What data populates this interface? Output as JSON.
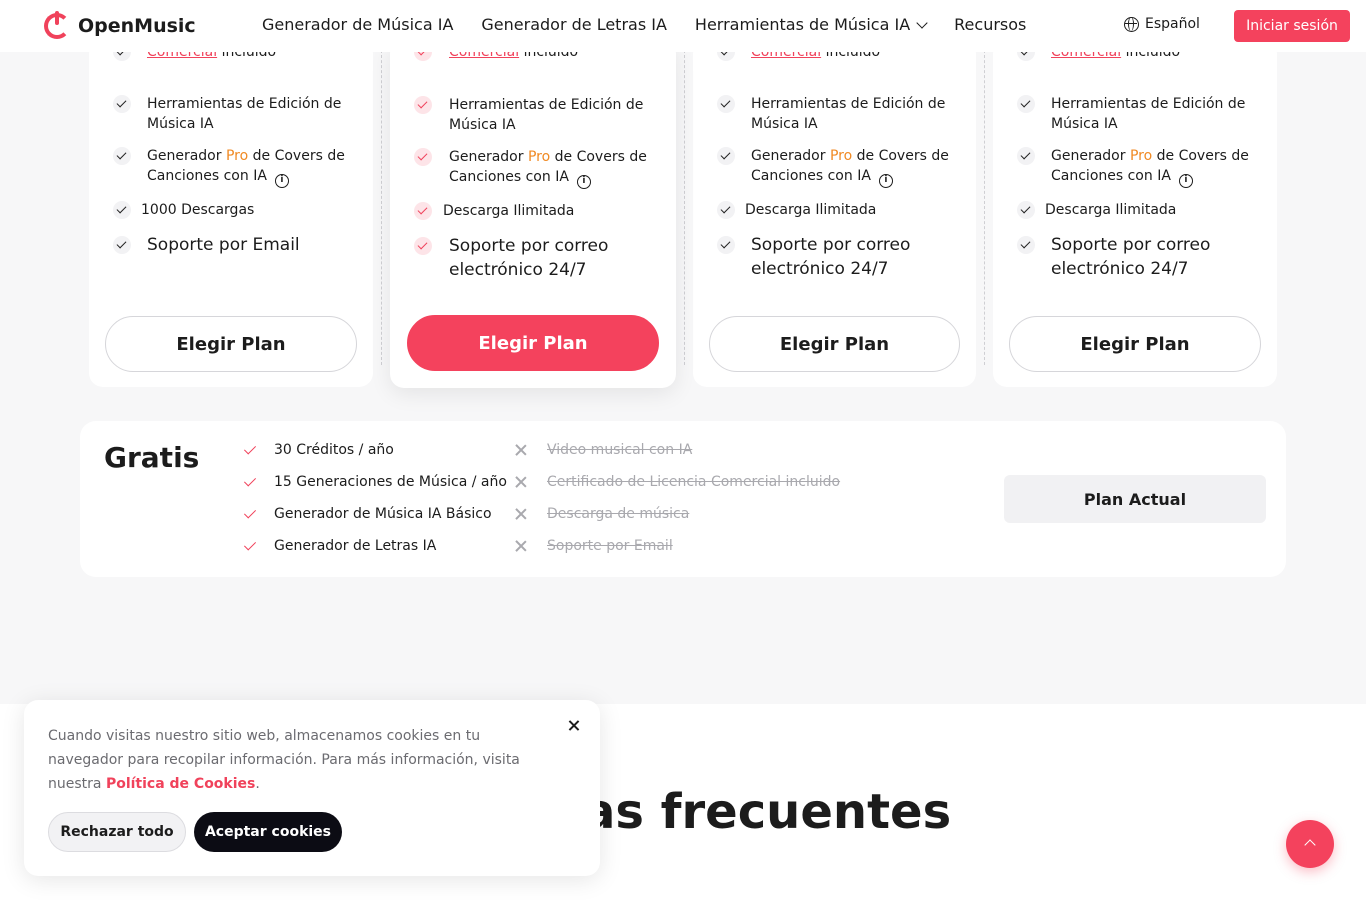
{
  "header": {
    "brand": "OpenMusic",
    "nav": [
      "Generador de Música IA",
      "Generador de Letras IA",
      "Herramientas de Música IA",
      "Recursos"
    ],
    "language": "Español",
    "login": "Iniciar sesión"
  },
  "plans": [
    {
      "license_link": "Comercial",
      "license_rest": "incluido",
      "editing_tools": "Herramientas de Edición de Música IA",
      "covers_pre": "Generador",
      "covers_pro": "Pro",
      "covers_post": "de Covers de Canciones con IA",
      "downloads": "1000 Descargas",
      "support": "Soporte por Email",
      "button": "Elegir Plan"
    },
    {
      "license_link": "Comercial",
      "license_rest": "incluido",
      "editing_tools": "Herramientas de Edición de Música IA",
      "covers_pre": "Generador",
      "covers_pro": "Pro",
      "covers_post": "de Covers de Canciones con IA",
      "downloads": "Descarga Ilimitada",
      "support": "Soporte por correo electrónico 24/7",
      "button": "Elegir Plan"
    },
    {
      "license_link": "Comercial",
      "license_rest": "incluido",
      "editing_tools": "Herramientas de Edición de Música IA",
      "covers_pre": "Generador",
      "covers_pro": "Pro",
      "covers_post": "de Covers de Canciones con IA",
      "downloads": "Descarga Ilimitada",
      "support": "Soporte por correo electrónico 24/7",
      "button": "Elegir Plan"
    },
    {
      "license_link": "Comercial",
      "license_rest": "incluido",
      "editing_tools": "Herramientas de Edición de Música IA",
      "covers_pre": "Generador",
      "covers_pro": "Pro",
      "covers_post": "de Covers de Canciones con IA",
      "downloads": "Descarga Ilimitada",
      "support": "Soporte por correo electrónico 24/7",
      "button": "Elegir Plan"
    }
  ],
  "free_plan": {
    "title": "Gratis",
    "included": [
      "30 Créditos / año",
      "15 Generaciones de Música / año",
      "Generador de Música IA Básico",
      "Generador de Letras IA"
    ],
    "excluded": [
      "Video musical con IA",
      "Certificado de Licencia Comercial incluido",
      "Descarga de música",
      "Soporte por Email"
    ],
    "button": "Plan Actual"
  },
  "faq_title": "tas frecuentes",
  "cookie": {
    "text": "Cuando visitas nuestro sitio web, almacenamos cookies en tu navegador para recopilar información. Para más información, visita nuestra",
    "policy_link": "Política de Cookies",
    "period": ".",
    "reject": "Rechazar todo",
    "accept": "Aceptar cookies"
  },
  "colors": {
    "accent": "#f4425d",
    "pro": "#f08a24"
  }
}
